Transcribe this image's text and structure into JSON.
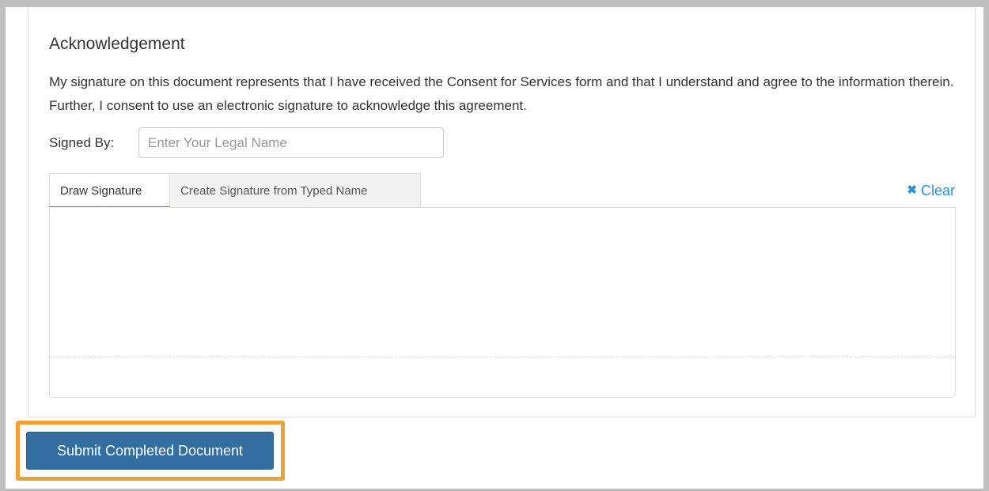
{
  "acknowledgement": {
    "title": "Acknowledgement",
    "text": "My signature on this document represents that I have received the Consent for Services form and that I understand and agree to the information therein. Further, I consent to use an electronic signature to acknowledge this agreement."
  },
  "signed_by": {
    "label": "Signed By:",
    "placeholder": "Enter Your Legal Name",
    "value": ""
  },
  "signature_tabs": {
    "draw_label": "Draw Signature",
    "typed_label": "Create Signature from Typed Name",
    "active": "Draw Signature"
  },
  "clear": {
    "icon": "close-icon",
    "icon_glyph": "✖",
    "label": "Clear",
    "color": "#2f8fd6"
  },
  "submit": {
    "label": "Submit Completed Document",
    "color": "#336f9e",
    "highlight_color": "#f0a03a"
  }
}
